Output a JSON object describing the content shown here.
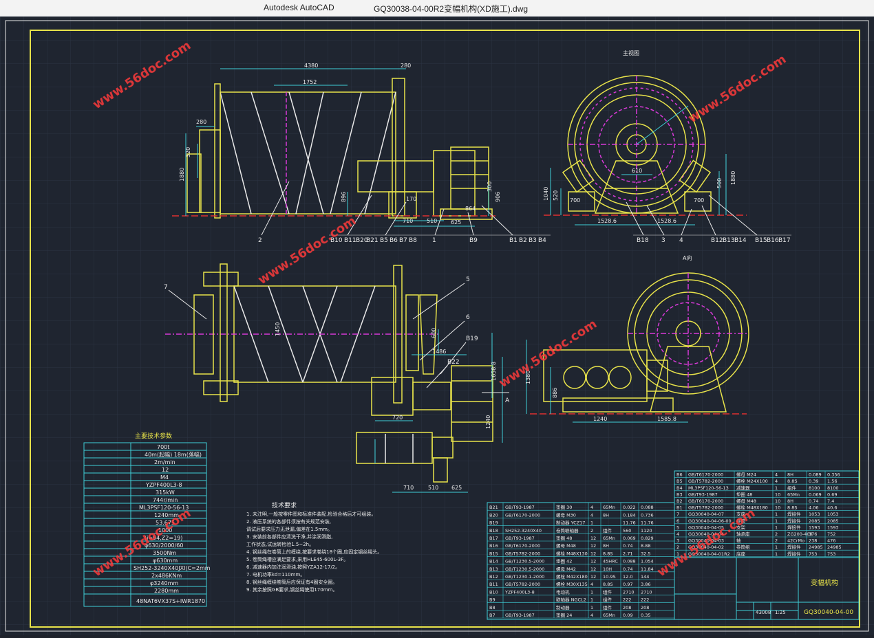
{
  "window": {
    "app_name": "Autodesk AutoCAD",
    "file_name": "GQ30038-04-00R2变幅机构(XD施工).dwg"
  },
  "colors": {
    "background": "#1f2530",
    "grid": "#2b3342",
    "yellow": "#e8e34a",
    "magenta": "#d83ad8",
    "cyan": "#3fd0d8",
    "white": "#e9e9e9",
    "red": "#e03030",
    "watermark": "#ff3b3b"
  },
  "watermark": "www.56doc.com",
  "drawing": {
    "dims_front": [
      "4380",
      "280",
      "1752",
      "280",
      "320",
      "1880",
      "896",
      "170",
      "510",
      "625",
      "710",
      "864",
      "300",
      "906"
    ],
    "balloons_front": [
      "B10",
      "B11",
      "B20",
      "B21",
      "B5",
      "B6",
      "B7",
      "B8",
      "B9",
      "B1",
      "B2",
      "B3",
      "B4",
      "1",
      "2"
    ],
    "dims_side": [
      "700",
      "520",
      "1040",
      "1528.6",
      "1528.6",
      "610",
      "700",
      "500",
      "1880"
    ],
    "balloons_side": [
      "B18",
      "3",
      "4",
      "B12",
      "B13",
      "B14",
      "B15",
      "B16",
      "B17"
    ],
    "side_view_label": "主视图",
    "dims_plan": [
      "1450",
      "720",
      "1486",
      "1658.8",
      "1240",
      "510",
      "710",
      "625",
      "600"
    ],
    "balloons_plan": [
      "7",
      "5",
      "6",
      "B19",
      "B22",
      "A"
    ],
    "section_label": "A向",
    "dims_aview": [
      "1380",
      "886",
      "1240",
      "1585.8"
    ],
    "tech_table_title": "主要技术参数",
    "tech_values": [
      "700t",
      "40m(起幅) 18m(落幅)",
      "2m/min",
      "12",
      "M4",
      "YZPF400L3-8",
      "315kW",
      "744r/min",
      "ML3PSF120-56-13",
      "1240mm",
      "53.675",
      "1000",
      "(i=94,Z2=19)",
      "φ630/2000/60",
      "3500Nm",
      "φ630mm",
      "SH252-3240X40JXI(C=2mm",
      "2x486KNm",
      "φ3240mm",
      "2280mm",
      "48NAT6VX37S+IWR1870"
    ],
    "tech_notes_title": "技术要求",
    "tech_notes": [
      "1. 未注明,一般按零件图和标准件装配,检验合格后才可组装。",
      "2. 液压系统的各部件须按有关规范安装,",
      "   调试后要求压力无泄漏,偏差在1.5mm。",
      "3. 安装前各部件应清洗干净,并涂润滑脂,",
      "   工作状态,试运转检验1.5~2h。",
      "4. 钢丝绳在卷筒上的缠绕,按要求卷绕18个圈,应固定钢丝绳头。",
      "5. 卷筒绳槽应满足要求,采用HLE45-600L-3F。",
      "6. 减速器内加注润滑油,按照YZA12-17/2。",
      "7. 电机功率kd=110mm。",
      "8. 钢丝绳缠绕卷筒后应保证有4圈安全圈。",
      "9. 其余按照GB要求,钢丝绳使用170mm。"
    ],
    "bom_left": [
      [
        "B21",
        "GB/T93-1987",
        "垫圈 30",
        "4",
        "65Mn",
        "0.022",
        "0.088"
      ],
      [
        "B20",
        "GB/T6170-2000",
        "螺母 M30",
        "4",
        "8H",
        "0.184",
        "0.736"
      ],
      [
        "B19",
        "",
        "制动器 YCZ17",
        "1",
        "",
        "11.76",
        "11.76"
      ],
      [
        "B18",
        "SH252-3240X40",
        "卷筒联轴器",
        "2",
        "组件",
        "560",
        "1120"
      ],
      [
        "B17",
        "GB/T93-1987",
        "垫圈 48",
        "12",
        "65Mn",
        "0.069",
        "0.829"
      ],
      [
        "B16",
        "GB/T6170-2000",
        "螺母 M48",
        "12",
        "8H",
        "0.74",
        "8.88"
      ],
      [
        "B15",
        "GB/T5782-2000",
        "螺栓 M48X130",
        "12",
        "8.8S",
        "2.71",
        "32.5"
      ],
      [
        "B14",
        "GB/T1230.5-2000",
        "垫圈 42",
        "12",
        "45HRC",
        "0.088",
        "1.054"
      ],
      [
        "B13",
        "GB/T1230.5-2000",
        "螺母 M42",
        "12",
        "10H",
        "0.74",
        "11.84"
      ],
      [
        "B12",
        "GB/T1230.1-2000",
        "螺栓 M42X180",
        "12",
        "10.9S",
        "12.0",
        "144"
      ],
      [
        "B11",
        "GB/T5782-2000",
        "螺栓 M30X135",
        "4",
        "8.8S",
        "0.97",
        "3.86"
      ],
      [
        "B10",
        "YZPF400L3-8",
        "电动机",
        "1",
        "组件",
        "2710",
        "2710"
      ],
      [
        "B9",
        "",
        "联轴器 NGCL2",
        "1",
        "组件",
        "222",
        "222"
      ],
      [
        "B8",
        "",
        "制动器",
        "1",
        "组件",
        "208",
        "208"
      ],
      [
        "B7",
        "GB/T93-1987",
        "垫圈 24",
        "4",
        "65Mn",
        "0.09",
        "0.35"
      ]
    ],
    "bom_right": [
      [
        "B6",
        "GB/T6170-2000",
        "螺母 M24",
        "4",
        "8H",
        "0.089",
        "0.356"
      ],
      [
        "B5",
        "GB/T5782-2000",
        "螺栓 M24X100",
        "4",
        "8.8S",
        "0.39",
        "1.56"
      ],
      [
        "B4",
        "ML3PSF120-56-13",
        "减速器",
        "1",
        "组件",
        "8100",
        "8100"
      ],
      [
        "B3",
        "GB/T93-1987",
        "垫圈 48",
        "10",
        "65Mn",
        "0.069",
        "0.69"
      ],
      [
        "B2",
        "GB/T6170-2000",
        "螺母 M48",
        "10",
        "8H",
        "0.74",
        "7.4"
      ],
      [
        "B1",
        "GB/T5782-2000",
        "螺栓 M48X180",
        "10",
        "8.8S",
        "4.06",
        "40.6"
      ],
      [
        "7",
        "GQ30040-04-07",
        "支座",
        "1",
        "焊接件",
        "1053",
        "1053"
      ],
      [
        "6",
        "GQ30040-04-06-00",
        "卷筒",
        "1",
        "焊接件",
        "2085",
        "2085"
      ],
      [
        "5",
        "GQ30040-04-05",
        "支架",
        "1",
        "焊接件",
        "1593",
        "1593"
      ],
      [
        "4",
        "GQ30040-04-04",
        "轴承座",
        "2",
        "ZG200-400",
        "376",
        "752"
      ],
      [
        "3",
        "GQ30040-04-03",
        "轴",
        "2",
        "42CrMo",
        "238",
        "476"
      ],
      [
        "2",
        "GQ30040-04-02",
        "卷筒组",
        "1",
        "焊接件",
        "24985",
        "24985"
      ],
      [
        "1",
        "GQ30040-04-01R2",
        "底座",
        "1",
        "焊接件",
        "753",
        "753"
      ]
    ],
    "title_block_name": "变幅机构",
    "title_block_code": "GQ30040-04-00",
    "title_block_scale": "1:25",
    "title_block_weight": "43008"
  }
}
